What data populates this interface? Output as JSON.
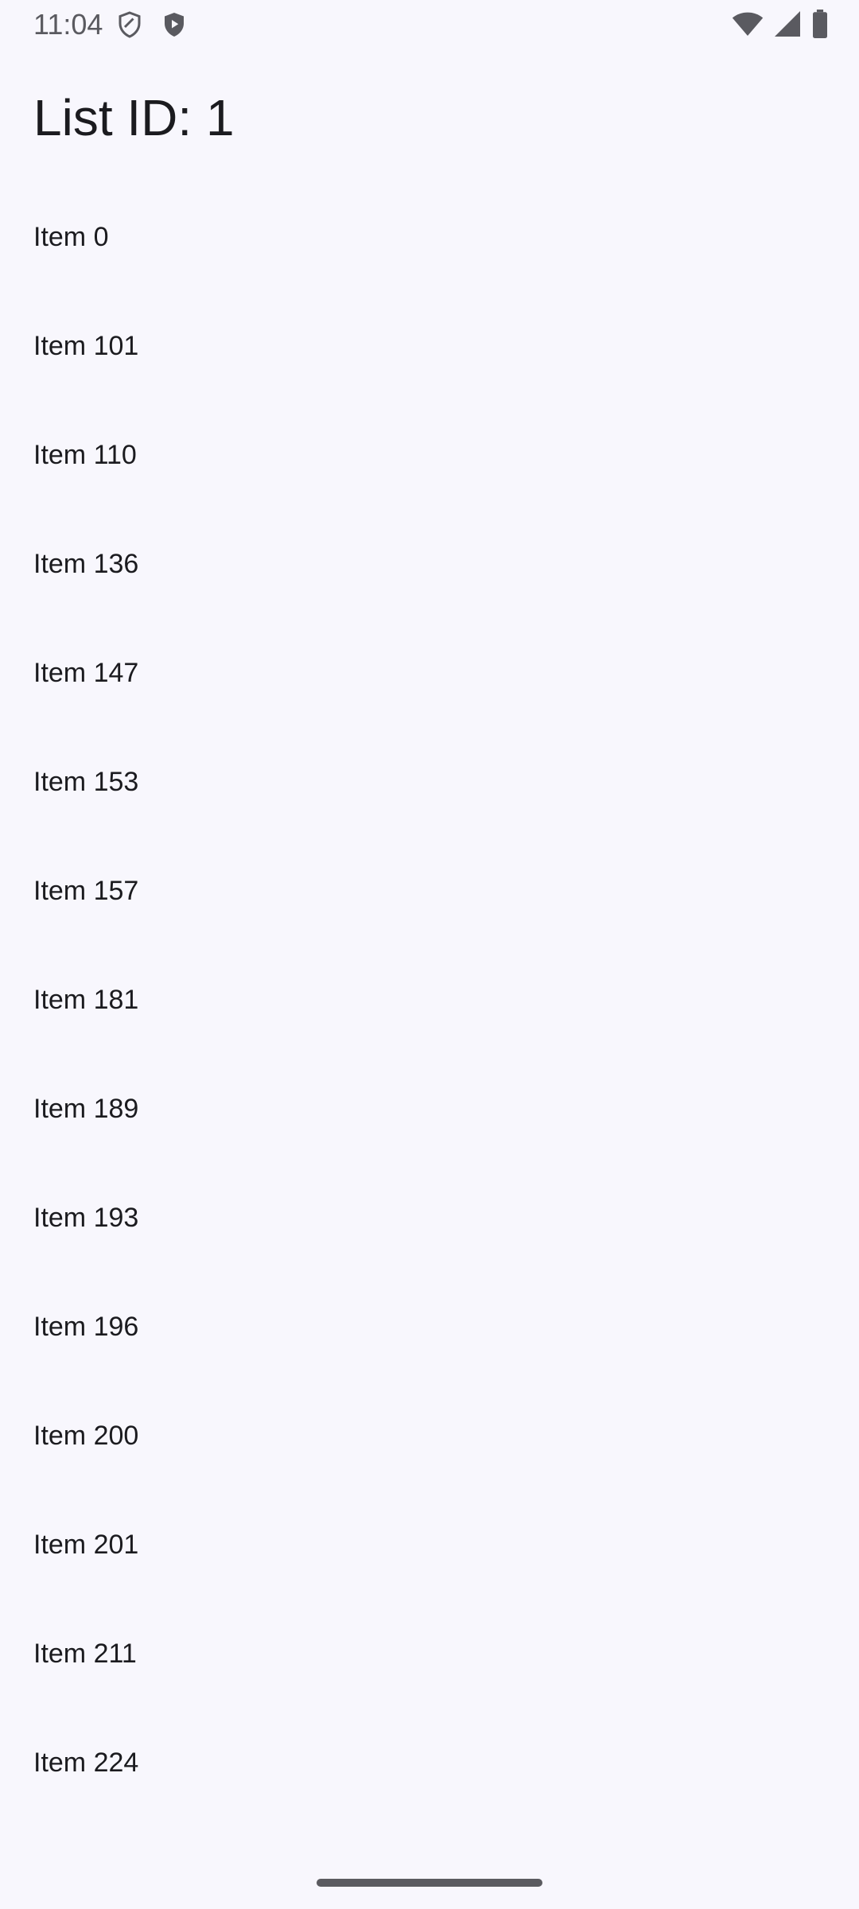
{
  "status_bar": {
    "time": "11:04",
    "left_icons": [
      "shield-outline-icon",
      "shield-play-icon"
    ],
    "right_icons": [
      "wifi-icon",
      "cellular-signal-icon",
      "battery-icon"
    ]
  },
  "page": {
    "title": "List ID: 1"
  },
  "list": {
    "items": [
      {
        "label": "Item 0"
      },
      {
        "label": "Item 101"
      },
      {
        "label": "Item 110"
      },
      {
        "label": "Item 136"
      },
      {
        "label": "Item 147"
      },
      {
        "label": "Item 153"
      },
      {
        "label": "Item 157"
      },
      {
        "label": "Item 181"
      },
      {
        "label": "Item 189"
      },
      {
        "label": "Item 193"
      },
      {
        "label": "Item 196"
      },
      {
        "label": "Item 200"
      },
      {
        "label": "Item 201"
      },
      {
        "label": "Item 211"
      },
      {
        "label": "Item 224"
      }
    ]
  },
  "colors": {
    "background": "#f8f7fd",
    "text": "#1b1b1f",
    "status_icons": "#5a5a60"
  }
}
